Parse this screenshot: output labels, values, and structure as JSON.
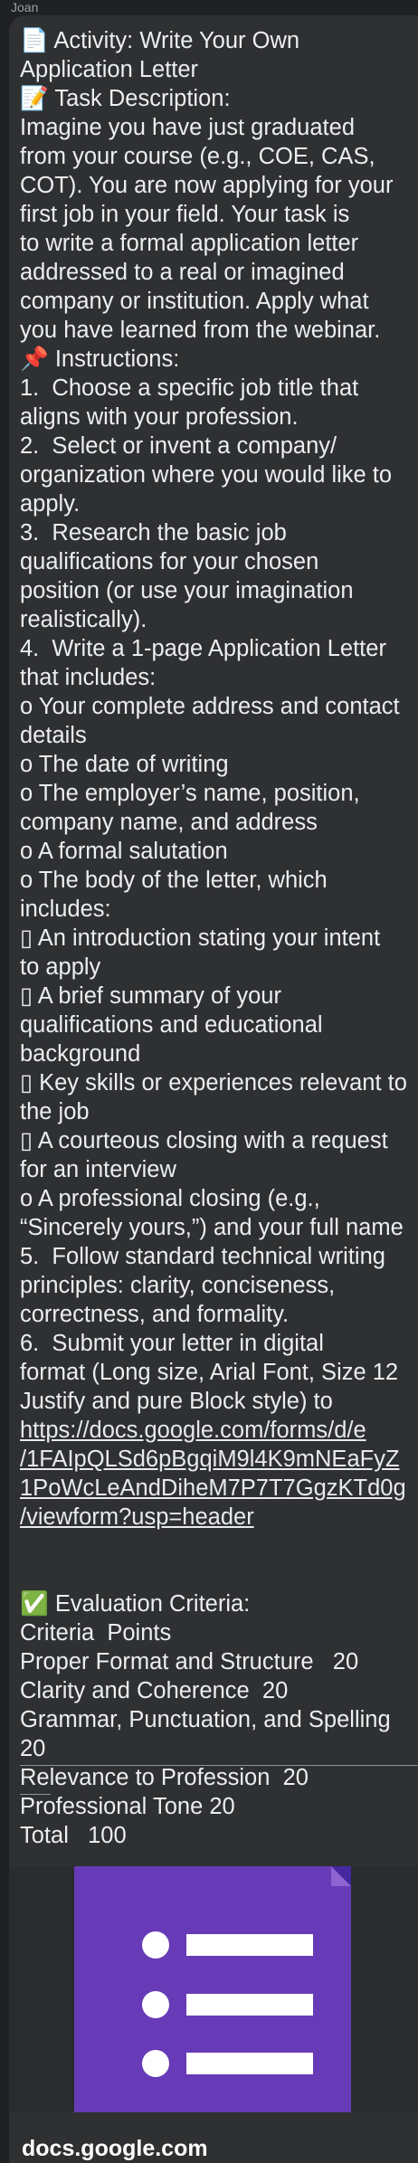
{
  "sender_name": "Joan",
  "message_lines": [
    {
      "text": "📄 Activity: Write Your Own"
    },
    {
      "text": "Application Letter"
    },
    {
      "text": "📝 Task Description:"
    },
    {
      "text": "Imagine you have just graduated"
    },
    {
      "text": "from your course (e.g., COE, CAS,"
    },
    {
      "text": "COT). You are now applying for your"
    },
    {
      "text": "first job in your field. Your task is"
    },
    {
      "text": "to write a formal application letter"
    },
    {
      "text": "addressed to a real or imagined"
    },
    {
      "text": "company or institution. Apply what"
    },
    {
      "text": "you have learned from the webinar."
    },
    {
      "text": "📌 Instructions:"
    },
    {
      "text": "1.  Choose a specific job title that"
    },
    {
      "text": "aligns with your profession."
    },
    {
      "text": "2.  Select or invent a company/"
    },
    {
      "text": "organization where you would like to"
    },
    {
      "text": "apply."
    },
    {
      "text": "3.  Research the basic job"
    },
    {
      "text": "qualifications for your chosen"
    },
    {
      "text": "position (or use your imagination"
    },
    {
      "text": "realistically)."
    },
    {
      "text": "4.  Write a 1-page Application Letter"
    },
    {
      "text": "that includes:"
    },
    {
      "text": "o Your complete address and contact"
    },
    {
      "text": "details"
    },
    {
      "text": "o The date of writing"
    },
    {
      "text": "o The employer’s name, position,"
    },
    {
      "text": "company name, and address"
    },
    {
      "text": "o A formal salutation"
    },
    {
      "text": "o The body of the letter, which"
    },
    {
      "text": "includes:"
    },
    {
      "text": "▯ An introduction stating your intent"
    },
    {
      "text": "to apply"
    },
    {
      "text": "▯ A brief summary of your"
    },
    {
      "text": "qualifications and educational"
    },
    {
      "text": "background"
    },
    {
      "text": "▯ Key skills or experiences relevant to"
    },
    {
      "text": "the job"
    },
    {
      "text": "▯ A courteous closing with a request"
    },
    {
      "text": "for an interview"
    },
    {
      "text": "o A professional closing (e.g.,"
    },
    {
      "text": "“Sincerely yours,”) and your full name"
    },
    {
      "text": "5.  Follow standard technical writing"
    },
    {
      "text": "principles: clarity, conciseness,"
    },
    {
      "text": "correctness, and formality."
    },
    {
      "text": "6.  Submit your letter in digital"
    },
    {
      "text": "format (Long size, Arial Font, Size 12"
    },
    {
      "text": "Justify and pure Block style) to"
    },
    {
      "text": "https://docs.google.com/forms/d/e",
      "link": true
    },
    {
      "text": "/1FAIpQLSd6pBgqiM9l4K9mNEaFyZ",
      "link": true
    },
    {
      "text": "1PoWcLeAndDiheM7P7T7GgzKTd0g",
      "link": true
    },
    {
      "text": "/viewform?usp=header",
      "link": true
    },
    {
      "text": ""
    },
    {
      "text": ""
    },
    {
      "text": "✅ Evaluation Criteria:"
    },
    {
      "text": "Criteria  Points"
    },
    {
      "text": "Proper Format and Structure   20"
    },
    {
      "text": "Clarity and Coherence  20"
    },
    {
      "text": "Grammar, Punctuation, and Spelling"
    },
    {
      "text": "20"
    },
    {
      "text": "Relevance to Profession  20"
    },
    {
      "text": "Professional Tone 20"
    },
    {
      "text": "Total   100"
    }
  ],
  "preview": {
    "caption": "docs.google.com",
    "icon": "google-forms-icon",
    "colors": {
      "form_purple": "#673ab7",
      "form_fold": "#4527a0"
    }
  }
}
